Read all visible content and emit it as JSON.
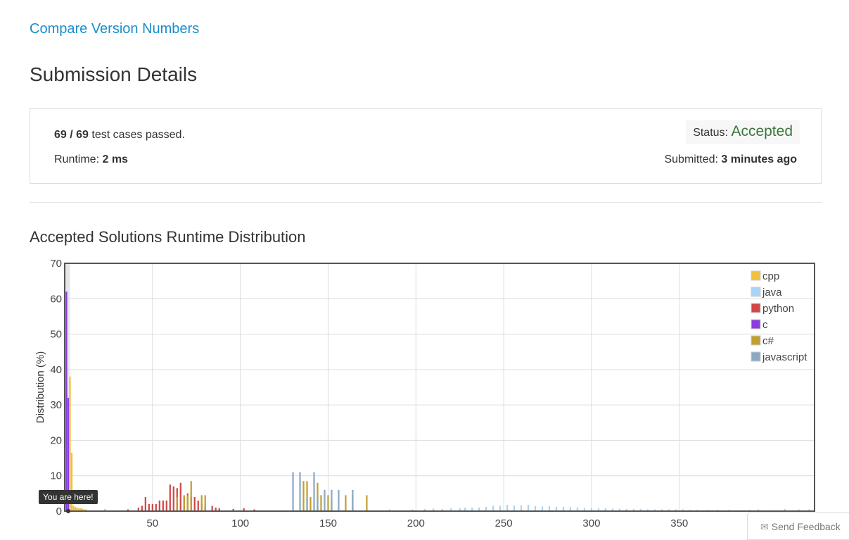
{
  "problem": {
    "title": "Compare Version Numbers"
  },
  "page": {
    "title": "Submission Details"
  },
  "submission": {
    "passed": "69 / 69",
    "passed_suffix": " test cases passed.",
    "runtime_label": "Runtime: ",
    "runtime_value": "2 ms",
    "status_label": "Status: ",
    "status_value": "Accepted",
    "submitted_label": "Submitted: ",
    "submitted_value": "3 minutes ago"
  },
  "tooltip": "You are here!",
  "feedback": {
    "label": "Send Feedback",
    "icon": "envelope-icon"
  },
  "chart_data": {
    "type": "bar",
    "title": "Accepted Solutions Runtime Distribution",
    "xlabel": "",
    "ylabel": "Distribution (%)",
    "xlim": [
      0,
      427
    ],
    "ylim": [
      0,
      70
    ],
    "xticks": [
      50,
      100,
      150,
      200,
      250,
      300,
      350
    ],
    "yticks": [
      0,
      10,
      20,
      30,
      40,
      50,
      60,
      70
    ],
    "grid": true,
    "legend_position": "top-right",
    "highlight_x": 2,
    "series": [
      {
        "name": "cpp",
        "color": "#f0c040",
        "points": [
          [
            3,
            38
          ],
          [
            4,
            16.5
          ],
          [
            5,
            1.5
          ],
          [
            6,
            1.2
          ],
          [
            7,
            1
          ],
          [
            8,
            0.8
          ],
          [
            9,
            0.8
          ],
          [
            10,
            0.7
          ],
          [
            11,
            0.5
          ],
          [
            12,
            0.5
          ],
          [
            23,
            0.6
          ]
        ]
      },
      {
        "name": "java",
        "color": "#a8d4f5",
        "points": [
          [
            185,
            0.5
          ],
          [
            198,
            0.5
          ],
          [
            205,
            0.6
          ],
          [
            210,
            0.7
          ],
          [
            215,
            0.6
          ],
          [
            220,
            0.8
          ],
          [
            225,
            0.8
          ],
          [
            228,
            1
          ],
          [
            232,
            1
          ],
          [
            236,
            1
          ],
          [
            240,
            1.2
          ],
          [
            244,
            1.5
          ],
          [
            248,
            1.5
          ],
          [
            252,
            1.8
          ],
          [
            256,
            1.6
          ],
          [
            260,
            1.6
          ],
          [
            264,
            1.8
          ],
          [
            268,
            1.4
          ],
          [
            272,
            1.3
          ],
          [
            276,
            1.4
          ],
          [
            280,
            1.2
          ],
          [
            284,
            1.2
          ],
          [
            288,
            1.1
          ],
          [
            292,
            1
          ],
          [
            296,
            0.9
          ],
          [
            300,
            0.8
          ],
          [
            304,
            0.8
          ],
          [
            308,
            0.8
          ],
          [
            312,
            0.7
          ],
          [
            316,
            0.7
          ],
          [
            320,
            0.6
          ],
          [
            324,
            0.6
          ],
          [
            328,
            0.6
          ],
          [
            332,
            0.5
          ],
          [
            336,
            0.5
          ],
          [
            340,
            0.5
          ],
          [
            344,
            0.5
          ],
          [
            348,
            0.5
          ],
          [
            352,
            0.5
          ],
          [
            356,
            0.4
          ],
          [
            360,
            0.4
          ],
          [
            366,
            0.4
          ],
          [
            372,
            0.4
          ],
          [
            378,
            0.4
          ],
          [
            384,
            0.3
          ],
          [
            390,
            0.4
          ],
          [
            395,
            0.5
          ],
          [
            402,
            0.3
          ],
          [
            410,
            0.6
          ],
          [
            418,
            0.5
          ],
          [
            424,
            0.5
          ]
        ]
      },
      {
        "name": "python",
        "color": "#d04848",
        "points": [
          [
            36,
            0.5
          ],
          [
            42,
            1
          ],
          [
            44,
            1.5
          ],
          [
            46,
            4
          ],
          [
            48,
            2
          ],
          [
            50,
            2
          ],
          [
            52,
            2
          ],
          [
            54,
            3
          ],
          [
            56,
            3
          ],
          [
            58,
            3
          ],
          [
            60,
            7.5
          ],
          [
            62,
            7
          ],
          [
            64,
            6.5
          ],
          [
            66,
            8
          ],
          [
            68,
            4
          ],
          [
            70,
            5
          ],
          [
            72,
            4
          ],
          [
            74,
            4
          ],
          [
            76,
            3
          ],
          [
            78,
            2
          ],
          [
            80,
            1.5
          ],
          [
            84,
            1.5
          ],
          [
            86,
            1
          ],
          [
            88,
            0.8
          ],
          [
            96,
            0.6
          ],
          [
            102,
            0.8
          ],
          [
            108,
            0.5
          ]
        ]
      },
      {
        "name": "c",
        "color": "#8a3ee0",
        "points": [
          [
            1,
            62
          ],
          [
            2,
            32
          ]
        ]
      },
      {
        "name": "c#",
        "color": "#c0a030",
        "points": [
          [
            64,
            4
          ],
          [
            68,
            4.5
          ],
          [
            70,
            4.5
          ],
          [
            72,
            8.5
          ],
          [
            78,
            4.5
          ],
          [
            80,
            4.5
          ],
          [
            136,
            8.5
          ],
          [
            138,
            8.5
          ],
          [
            140,
            4
          ],
          [
            144,
            8
          ],
          [
            146,
            4.5
          ],
          [
            150,
            4.5
          ],
          [
            152,
            3
          ],
          [
            160,
            4.5
          ],
          [
            164,
            4.5
          ],
          [
            172,
            4.5
          ]
        ]
      },
      {
        "name": "javascript",
        "color": "#8aa9c6",
        "points": [
          [
            130,
            11
          ],
          [
            134,
            11
          ],
          [
            138,
            4
          ],
          [
            142,
            11
          ],
          [
            144,
            4
          ],
          [
            148,
            6
          ],
          [
            152,
            6
          ],
          [
            156,
            6
          ],
          [
            164,
            6
          ]
        ]
      }
    ]
  }
}
